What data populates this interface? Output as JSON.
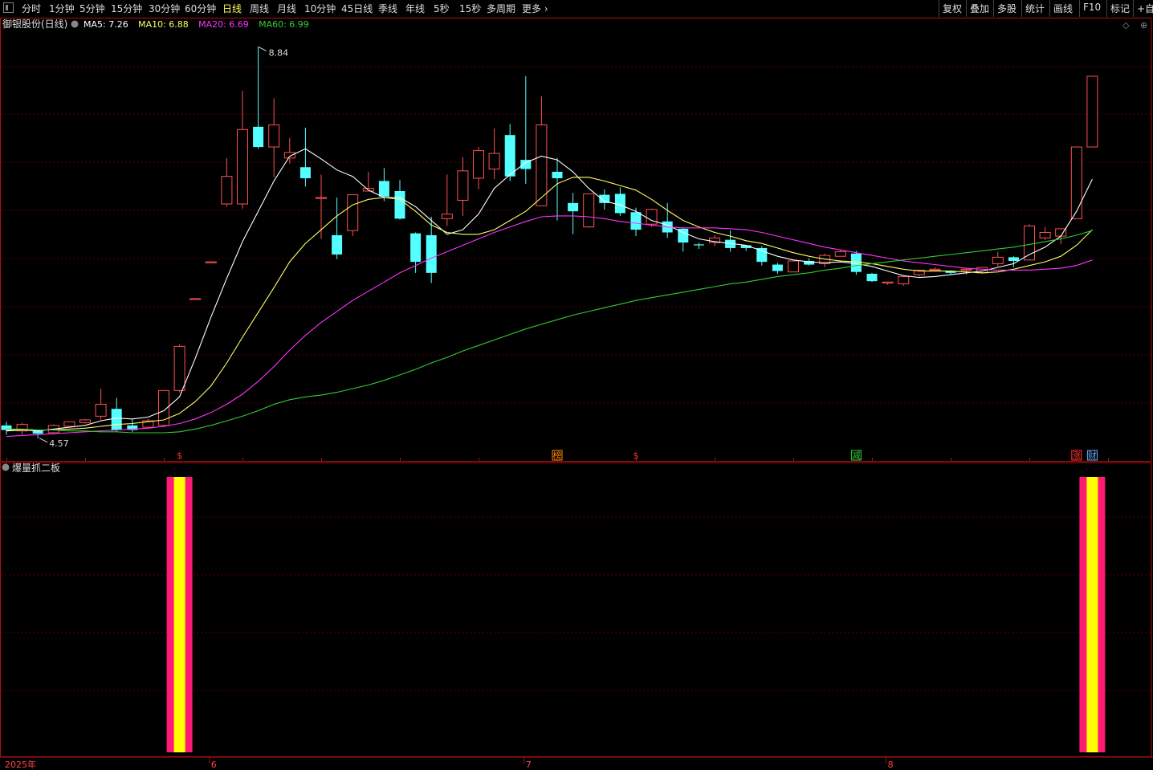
{
  "toolbar": {
    "periods": [
      "分时",
      "1分钟",
      "5分钟",
      "15分钟",
      "30分钟",
      "60分钟",
      "日线",
      "周线",
      "月线",
      "10分钟",
      "45日线",
      "季线",
      "年线",
      "5秒",
      "15秒",
      "多周期",
      "更多"
    ],
    "active_period": "日线",
    "right_buttons": [
      "复权",
      "叠加",
      "多股",
      "统计",
      "画线",
      "F10",
      "标记",
      "+自选"
    ]
  },
  "main_panel": {
    "stock_name": "御银股份(日线)",
    "ma": [
      {
        "label": "MA5: 7.26",
        "color": "#ffffff"
      },
      {
        "label": "MA10: 6.88",
        "color": "#ffff66"
      },
      {
        "label": "MA20: 6.69",
        "color": "#ff33ff"
      },
      {
        "label": "MA60: 6.99",
        "color": "#33cc33"
      }
    ],
    "high_label": "8.84",
    "low_label": "4.57",
    "markers": [
      {
        "text": "$",
        "index": 11,
        "color": "#ff3333"
      },
      {
        "text": "榜",
        "index": 35,
        "color": "#ff8800"
      },
      {
        "text": "$",
        "index": 40,
        "color": "#ff3333"
      },
      {
        "text": "减",
        "index": 54,
        "color": "#33cc33"
      },
      {
        "text": "涨",
        "index": 68,
        "color": "#ff3333"
      },
      {
        "text": "财",
        "index": 69,
        "color": "#66aaff"
      }
    ]
  },
  "indicator_panel": {
    "title": "爆量抓二板",
    "signal_indices": [
      11,
      69
    ]
  },
  "x_axis": {
    "labels": [
      {
        "text": "2025年",
        "index": 1
      },
      {
        "text": "6",
        "index": 13
      },
      {
        "text": "7",
        "index": 33
      },
      {
        "text": "8",
        "index": 56
      }
    ]
  },
  "chart_data": {
    "type": "candlestick",
    "ylim": [
      4.5,
      9.0
    ],
    "candles": [
      [
        4.72,
        4.67,
        4.76,
        4.62
      ],
      [
        4.66,
        4.73,
        4.75,
        4.62
      ],
      [
        4.66,
        4.63,
        4.67,
        4.58
      ],
      [
        4.64,
        4.72,
        4.73,
        4.63
      ],
      [
        4.71,
        4.76,
        4.76,
        4.7
      ],
      [
        4.75,
        4.78,
        4.79,
        4.74
      ],
      [
        4.82,
        4.95,
        5.12,
        4.78
      ],
      [
        4.9,
        4.67,
        5.02,
        4.65
      ],
      [
        4.72,
        4.67,
        4.79,
        4.65
      ],
      [
        4.7,
        4.77,
        4.79,
        4.69
      ],
      [
        4.72,
        5.1,
        5.1,
        4.7
      ],
      [
        5.1,
        5.58,
        5.6,
        5.08
      ],
      [
        6.1,
        6.1,
        6.1,
        6.1
      ],
      [
        6.5,
        6.5,
        6.5,
        6.5
      ],
      [
        7.13,
        7.43,
        7.63,
        7.1
      ],
      [
        7.13,
        7.94,
        8.36,
        7.08
      ],
      [
        7.97,
        7.75,
        8.84,
        7.73
      ],
      [
        7.75,
        7.99,
        8.28,
        7.42
      ],
      [
        7.63,
        7.69,
        7.85,
        7.57
      ],
      [
        7.53,
        7.41,
        7.96,
        7.32
      ],
      [
        7.2,
        7.2,
        7.45,
        6.75
      ],
      [
        6.79,
        6.58,
        7.2,
        6.53
      ],
      [
        6.84,
        7.23,
        7.23,
        6.78
      ],
      [
        7.27,
        7.3,
        7.48,
        7.27
      ],
      [
        7.38,
        7.21,
        7.52,
        7.16
      ],
      [
        7.27,
        6.97,
        7.39,
        6.96
      ],
      [
        6.81,
        6.5,
        6.82,
        6.38
      ],
      [
        6.79,
        6.38,
        6.99,
        6.27
      ],
      [
        6.97,
        7.02,
        7.45,
        6.89
      ],
      [
        7.17,
        7.49,
        7.64,
        7.0
      ],
      [
        7.41,
        7.71,
        7.75,
        7.29
      ],
      [
        7.51,
        7.68,
        7.95,
        7.4
      ],
      [
        7.88,
        7.43,
        8.0,
        7.38
      ],
      [
        7.61,
        7.51,
        8.52,
        7.35
      ],
      [
        7.11,
        7.99,
        8.3,
        7.11
      ],
      [
        7.48,
        7.41,
        7.63,
        6.95
      ],
      [
        7.14,
        7.05,
        7.25,
        6.8
      ],
      [
        6.88,
        7.24,
        7.24,
        6.87
      ],
      [
        7.23,
        7.14,
        7.29,
        7.07
      ],
      [
        7.24,
        7.03,
        7.31,
        7.0
      ],
      [
        7.04,
        6.85,
        7.09,
        6.78
      ],
      [
        6.91,
        7.07,
        7.08,
        6.88
      ],
      [
        6.94,
        6.82,
        7.14,
        6.76
      ],
      [
        6.86,
        6.71,
        6.87,
        6.61
      ],
      [
        6.69,
        6.68,
        6.71,
        6.64
      ],
      [
        6.71,
        6.76,
        6.79,
        6.67
      ],
      [
        6.74,
        6.65,
        6.84,
        6.61
      ],
      [
        6.68,
        6.65,
        6.68,
        6.62
      ],
      [
        6.65,
        6.5,
        6.67,
        6.46
      ],
      [
        6.47,
        6.4,
        6.49,
        6.37
      ],
      [
        6.39,
        6.51,
        6.51,
        6.39
      ],
      [
        6.51,
        6.47,
        6.54,
        6.46
      ],
      [
        6.48,
        6.57,
        6.59,
        6.44
      ],
      [
        6.56,
        6.61,
        6.63,
        6.56
      ],
      [
        6.59,
        6.39,
        6.62,
        6.36
      ],
      [
        6.37,
        6.29,
        6.38,
        6.28
      ],
      [
        6.28,
        6.28,
        6.28,
        6.25
      ],
      [
        6.26,
        6.34,
        6.34,
        6.24
      ],
      [
        6.36,
        6.41,
        6.41,
        6.34
      ],
      [
        6.42,
        6.42,
        6.44,
        6.41
      ],
      [
        6.4,
        6.38,
        6.4,
        6.36
      ],
      [
        6.41,
        6.42,
        6.42,
        6.36
      ],
      [
        6.38,
        6.44,
        6.44,
        6.37
      ],
      [
        6.48,
        6.55,
        6.61,
        6.45
      ],
      [
        6.55,
        6.51,
        6.56,
        6.44
      ],
      [
        6.52,
        6.89,
        6.91,
        6.52
      ],
      [
        6.76,
        6.82,
        6.88,
        6.74
      ],
      [
        6.78,
        6.86,
        6.86,
        6.69
      ],
      [
        6.97,
        7.75,
        7.75,
        6.97
      ],
      [
        7.75,
        8.52,
        8.52,
        7.75
      ]
    ],
    "ma_series": [
      {
        "name": "MA5",
        "color": "#ffffff",
        "values": [
          4.66,
          4.67,
          4.66,
          4.68,
          4.7,
          4.72,
          4.77,
          4.8,
          4.79,
          4.81,
          4.88,
          5.03,
          5.45,
          5.9,
          6.32,
          6.72,
          7.05,
          7.38,
          7.65,
          7.73,
          7.62,
          7.5,
          7.43,
          7.28,
          7.2,
          7.2,
          7.1,
          6.95,
          6.8,
          6.85,
          7.02,
          7.3,
          7.45,
          7.58,
          7.65,
          7.61,
          7.48,
          7.3,
          7.16,
          7.12,
          7.05,
          6.95,
          6.9,
          6.82,
          6.75,
          6.72,
          6.7,
          6.68,
          6.62,
          6.56,
          6.52,
          6.5,
          6.49,
          6.5,
          6.48,
          6.45,
          6.4,
          6.35,
          6.33,
          6.34,
          6.36,
          6.38,
          6.4,
          6.44,
          6.48,
          6.58,
          6.66,
          6.78,
          7.05,
          7.4
        ]
      },
      {
        "name": "MA10",
        "color": "#ffff66",
        "values": [
          4.67,
          4.67,
          4.67,
          4.67,
          4.68,
          4.69,
          4.71,
          4.73,
          4.74,
          4.76,
          4.78,
          4.85,
          4.98,
          5.15,
          5.4,
          5.68,
          5.95,
          6.22,
          6.5,
          6.7,
          6.85,
          7.0,
          7.12,
          7.18,
          7.2,
          7.18,
          7.05,
          6.9,
          6.82,
          6.8,
          6.8,
          6.85,
          6.95,
          7.05,
          7.2,
          7.35,
          7.42,
          7.42,
          7.38,
          7.33,
          7.28,
          7.18,
          7.06,
          6.95,
          6.88,
          6.82,
          6.78,
          6.73,
          6.7,
          6.65,
          6.6,
          6.56,
          6.53,
          6.51,
          6.5,
          6.48,
          6.45,
          6.42,
          6.4,
          6.4,
          6.4,
          6.39,
          6.38,
          6.39,
          6.42,
          6.46,
          6.5,
          6.56,
          6.68,
          6.85
        ]
      },
      {
        "name": "MA20",
        "color": "#ff33ff",
        "values": [
          4.6,
          4.61,
          4.62,
          4.63,
          4.64,
          4.65,
          4.66,
          4.67,
          4.68,
          4.69,
          4.71,
          4.74,
          4.79,
          4.86,
          4.95,
          5.06,
          5.2,
          5.36,
          5.54,
          5.7,
          5.84,
          5.96,
          6.08,
          6.18,
          6.28,
          6.38,
          6.46,
          6.54,
          6.61,
          6.68,
          6.75,
          6.82,
          6.88,
          6.94,
          6.99,
          7.0,
          7.0,
          6.99,
          6.97,
          6.94,
          6.92,
          6.9,
          6.88,
          6.87,
          6.87,
          6.87,
          6.86,
          6.85,
          6.82,
          6.78,
          6.74,
          6.7,
          6.66,
          6.63,
          6.6,
          6.57,
          6.54,
          6.51,
          6.49,
          6.47,
          6.45,
          6.43,
          6.42,
          6.41,
          6.41,
          6.41,
          6.42,
          6.43,
          6.46,
          6.52
        ]
      },
      {
        "name": "MA60",
        "color": "#33cc33",
        "values": [
          4.68,
          4.68,
          4.67,
          4.67,
          4.66,
          4.66,
          4.65,
          4.65,
          4.64,
          4.64,
          4.64,
          4.65,
          4.68,
          4.72,
          4.77,
          4.82,
          4.88,
          4.95,
          5.0,
          5.03,
          5.05,
          5.08,
          5.12,
          5.16,
          5.21,
          5.27,
          5.33,
          5.4,
          5.46,
          5.53,
          5.59,
          5.65,
          5.71,
          5.77,
          5.82,
          5.87,
          5.92,
          5.96,
          6.0,
          6.04,
          6.08,
          6.11,
          6.14,
          6.17,
          6.2,
          6.23,
          6.26,
          6.28,
          6.31,
          6.34,
          6.36,
          6.38,
          6.41,
          6.43,
          6.46,
          6.48,
          6.5,
          6.52,
          6.54,
          6.56,
          6.58,
          6.6,
          6.62,
          6.64,
          6.66,
          6.69,
          6.72,
          6.75,
          6.79,
          6.84
        ]
      }
    ]
  }
}
